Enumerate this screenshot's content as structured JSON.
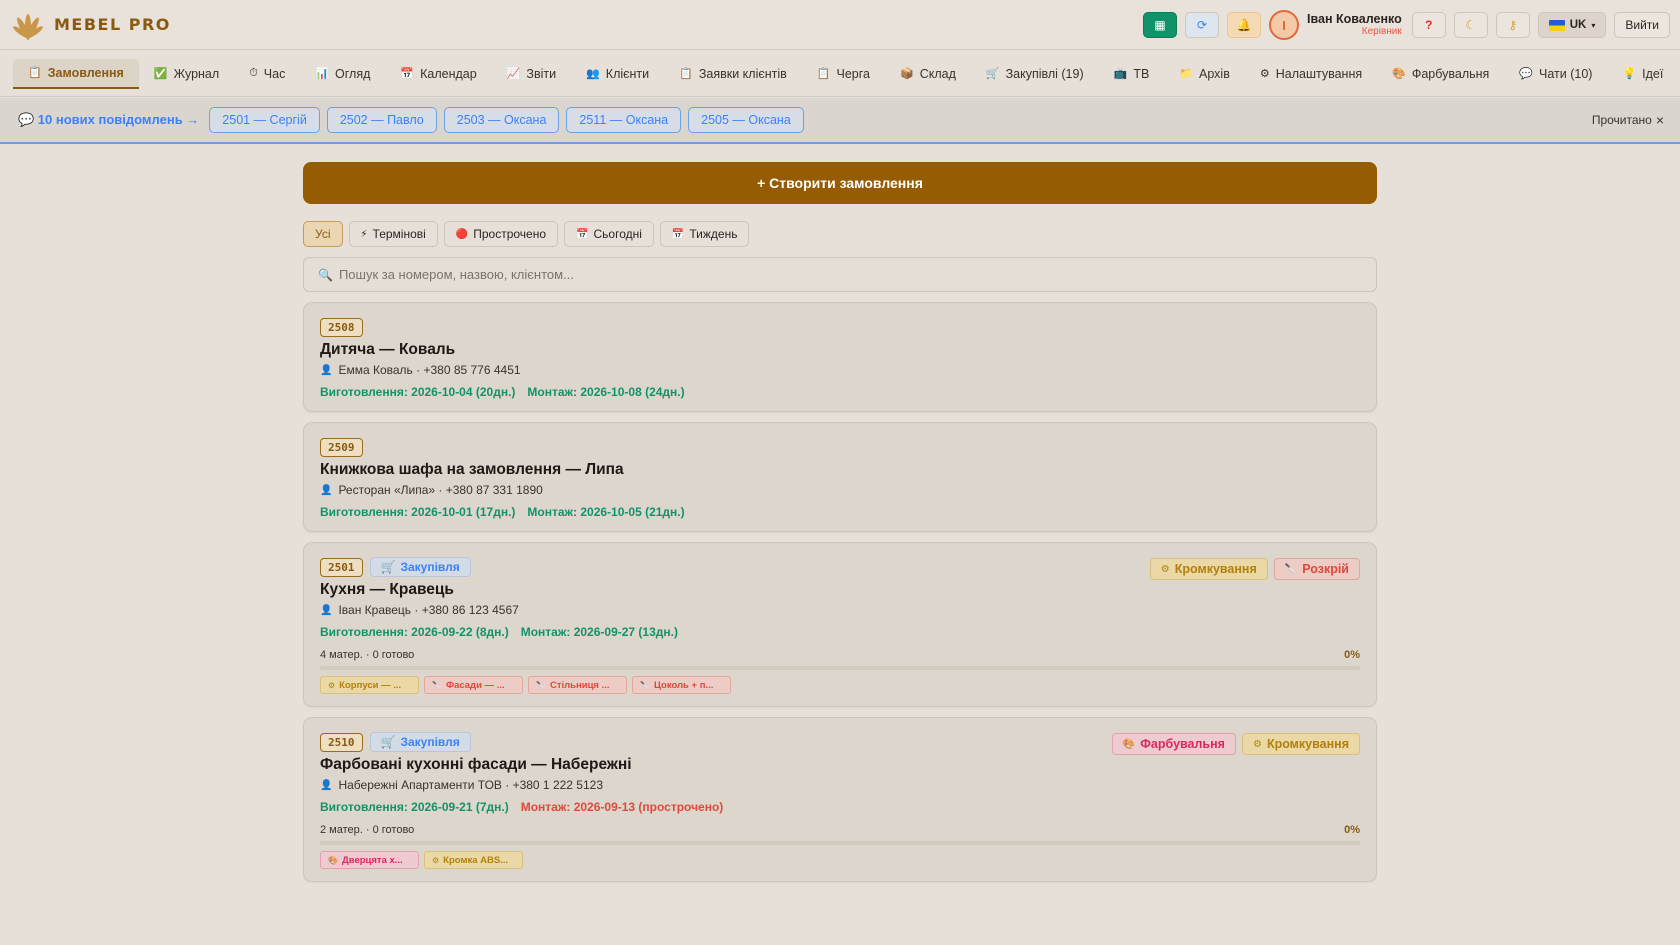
{
  "app": {
    "logo_text": "MEBEL PRO",
    "brand_color": "#955c03"
  },
  "header": {
    "icons": [
      "grid-icon",
      "refresh-icon",
      "bell-icon"
    ],
    "avatar_letter": "І",
    "user_name": "Іван Коваленко",
    "user_role": "Керівник",
    "help_label": "?",
    "theme_icon": "moon-icon",
    "key_icon": "key-icon",
    "lang_label": "UK",
    "logout_label": "Вийти"
  },
  "nav": {
    "items": [
      {
        "icon": "📋",
        "label": "Замовлення"
      },
      {
        "icon": "✅",
        "label": "Журнал"
      },
      {
        "icon": "⏱",
        "label": "Час"
      },
      {
        "icon": "📊",
        "label": "Огляд"
      },
      {
        "icon": "📅",
        "label": "Календар"
      },
      {
        "icon": "📈",
        "label": "Звіти"
      },
      {
        "icon": "👥",
        "label": "Клієнти"
      },
      {
        "icon": "📋",
        "label": "Заявки клієнтів"
      },
      {
        "icon": "📋",
        "label": "Черга"
      },
      {
        "icon": "📦",
        "label": "Склад"
      },
      {
        "icon": "🛒",
        "label": "Закупівлі (19)"
      },
      {
        "icon": "📺",
        "label": "ТВ"
      },
      {
        "icon": "📁",
        "label": "Архів"
      },
      {
        "icon": "⚙",
        "label": "Налаштування"
      },
      {
        "icon": "🎨",
        "label": "Фарбувальня"
      },
      {
        "icon": "💬",
        "label": "Чати (10)"
      },
      {
        "icon": "💡",
        "label": "Ідеї"
      }
    ]
  },
  "notifications": {
    "text": "💬 10 нових повідомлень →",
    "chips": [
      "2501 — Сергій",
      "2502 — Павло",
      "2503 — Оксана",
      "2511 — Оксана",
      "2505 — Оксана"
    ],
    "read_label": "Прочитано"
  },
  "main": {
    "create_label": "+ Створити замовлення",
    "filters": [
      {
        "icon": "",
        "label": "Усі"
      },
      {
        "icon": "⚡",
        "label": "Термінові"
      },
      {
        "icon": "🔴",
        "label": "Прострочено"
      },
      {
        "icon": "📅",
        "label": "Сьогодні"
      },
      {
        "icon": "📅",
        "label": "Тиждень"
      }
    ],
    "search_placeholder": "Пошук за номером, назвою, клієнтом..."
  },
  "orders": [
    {
      "number": "2508",
      "title": "Дитяча — Коваль",
      "client": "Емма Коваль · +380 85 776 4451",
      "production": "Виготовлення: 2026-10-04 (20дн.)",
      "install": "Монтаж: 2026-10-08 (24дн.)"
    },
    {
      "number": "2509",
      "title": "Книжкова шафа на замовлення — Липа",
      "client": "Ресторан «Липа» · +380 87 331 1890",
      "production": "Виготовлення: 2026-10-01 (17дн.)",
      "install": "Монтаж: 2026-10-05 (21дн.)"
    },
    {
      "number": "2501",
      "stage": "Закупівля",
      "tags": [
        {
          "label": "Кромкування",
          "color": "yellow"
        },
        {
          "label": "Розкрій",
          "color": "red"
        }
      ],
      "title": "Кухня — Кравець",
      "client": "Іван Кравець · +380 86 123 4567",
      "production": "Виготовлення: 2026-09-22 (8дн.)",
      "install": "Монтаж: 2026-09-27 (13дн.)",
      "materials": "4 матер. · 0 готово",
      "progress_label": "0%",
      "progress": 0,
      "mini_tags": [
        {
          "label": "Корпуси — ...",
          "color": "yellow"
        },
        {
          "label": "Фасади — ...",
          "color": "red"
        },
        {
          "label": "Стільниця ...",
          "color": "red"
        },
        {
          "label": "Цоколь + п...",
          "color": "red"
        }
      ]
    },
    {
      "number": "2510",
      "stage": "Закупівля",
      "tags": [
        {
          "label": "Фарбувальня",
          "color": "pink"
        },
        {
          "label": "Кромкування",
          "color": "yellow"
        }
      ],
      "title": "Фарбовані кухонні фасади — Набережні",
      "client": "Набережні Апартаменти ТОВ · +380 1 222 5123",
      "production": "Виготовлення: 2026-09-21 (7дн.)",
      "install": "Монтаж: 2026-09-13 (прострочено)",
      "materials": "2 матер. · 0 готово",
      "progress_label": "0%",
      "progress": 0,
      "mini_tags": [
        {
          "label": "Дверцята х...",
          "color": "pink"
        },
        {
          "label": "Кромка ABS...",
          "color": "yellow"
        }
      ]
    }
  ]
}
